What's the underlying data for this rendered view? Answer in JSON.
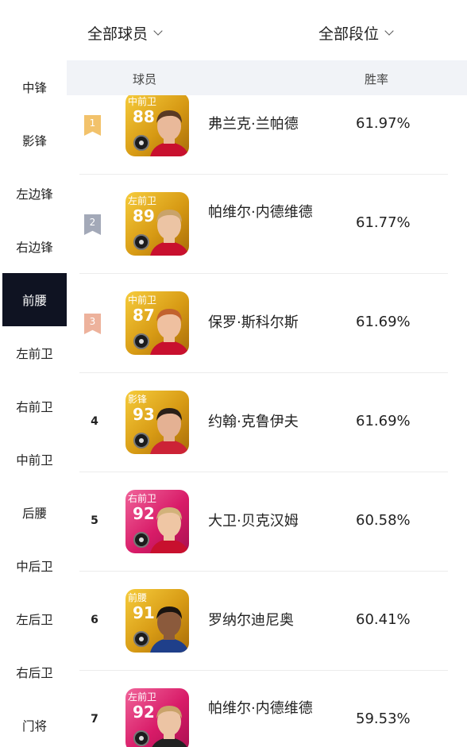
{
  "filters": {
    "player": "全部球员",
    "rank": "全部段位"
  },
  "header": {
    "player_col": "球员",
    "winrate_col": "胜率"
  },
  "sidebar": {
    "items": [
      "中锋",
      "影锋",
      "左边锋",
      "右边锋",
      "前腰",
      "左前卫",
      "右前卫",
      "中前卫",
      "后腰",
      "中后卫",
      "左后卫",
      "右后卫",
      "门将"
    ],
    "active": "前腰"
  },
  "players": [
    {
      "rank": "1",
      "position": "中前卫",
      "rating": "88",
      "name": "弗兰克·兰帕德",
      "winrate": "61.97%",
      "card_style": "gold",
      "flag_color": "#f2c26b"
    },
    {
      "rank": "2",
      "position": "左前卫",
      "rating": "89",
      "name": "帕维尔·内德维德",
      "winrate": "61.77%",
      "card_style": "gold",
      "flag_color": "#a3a9b8"
    },
    {
      "rank": "3",
      "position": "中前卫",
      "rating": "87",
      "name": "保罗·斯科尔斯",
      "winrate": "61.69%",
      "card_style": "gold",
      "flag_color": "#edb29c"
    },
    {
      "rank": "4",
      "position": "影锋",
      "rating": "93",
      "name": "约翰·克鲁伊夫",
      "winrate": "61.69%",
      "card_style": "gold",
      "flag_color": ""
    },
    {
      "rank": "5",
      "position": "右前卫",
      "rating": "92",
      "name": "大卫·贝克汉姆",
      "winrate": "60.58%",
      "card_style": "pink",
      "flag_color": ""
    },
    {
      "rank": "6",
      "position": "前腰",
      "rating": "91",
      "name": "罗纳尔迪尼奥",
      "winrate": "60.41%",
      "card_style": "gold",
      "flag_color": ""
    },
    {
      "rank": "7",
      "position": "左前卫",
      "rating": "92",
      "name": "帕维尔·内德维德",
      "winrate": "59.53%",
      "card_style": "pink",
      "flag_color": ""
    }
  ]
}
